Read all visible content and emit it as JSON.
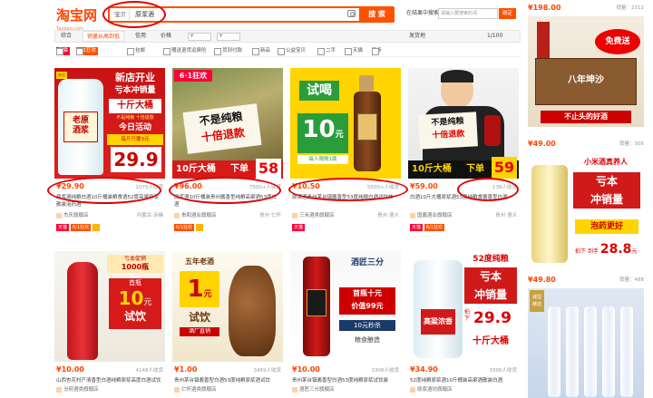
{
  "header": {
    "logo": "淘宝网",
    "logo_sub": "Taobao.com",
    "search_tab": "宝贝",
    "search_value": "原浆酒",
    "search_button": "搜 索",
    "instore_label": "在结果中搜索",
    "instore_placeholder": "请输入要搜索的词",
    "instore_button": "确定"
  },
  "sortbar": {
    "items": [
      "综合",
      "销量从高到低",
      "信用",
      "价格"
    ],
    "price_from": "¥",
    "price_to": "¥",
    "ship": "发货地",
    "page": "1/100"
  },
  "filters": [
    "包邮",
    "赠送退货运费险",
    "货到付款",
    "新品",
    "公益宝贝",
    "二手",
    "天猫",
    "更多"
  ],
  "products": [
    {
      "price": "¥29.90",
      "sold": "1075人收货",
      "title": "原浆酒纯粮白酒10斤桶装粮食酒52度高粱原浆散装泡药酒",
      "shop": "杰庆旗舰店",
      "loc": "内蒙古 赤峰",
      "img_texts": [
        "新店开业",
        "亏本冲销量",
        "老原",
        "酒浆",
        "十斤大桶",
        "不是纯粮 十倍退款",
        "今日活动",
        "29.9",
        "每斤只要3元"
      ]
    },
    {
      "price": "¥96.00",
      "sold": "7500+人收货",
      "title": "原浆酒10斤桶装贵州酱香型纯粮高粱酒53度白酒",
      "shop": "贵和酒业旗舰店",
      "loc": "贵州 仁怀",
      "img_texts": [
        "6·1狂欢",
        "不是纯粮",
        "十倍退款",
        "10斤大桶",
        "下单",
        "58"
      ]
    },
    {
      "price": "¥10.50",
      "sold": "5500+人收货",
      "title": "原浆酒贵州茅台镇酱香型53度纯粮白酒试饮装",
      "shop": "三禾酒类旗舰店",
      "loc": "贵州 遵义",
      "img_texts": [
        "试喝",
        "10",
        "元",
        "每人限购1瓶"
      ]
    },
    {
      "price": "¥59.00",
      "sold": "138人收货",
      "title": "白酒10斤大桶原浆酒53度纯粮食酱香型白酒",
      "shop": "国酱酒业旗舰店",
      "loc": "贵州 遵义",
      "img_texts": [
        "不是纯粮",
        "十倍退款",
        "10斤大桶",
        "下单",
        "59"
      ]
    },
    {
      "price": "¥10.00",
      "sold": "4148人收货",
      "title": "山西杏花村产清香型白酒纯粮原浆高度白酒试饮装",
      "shop": "汾府酒类旗舰店",
      "loc": "山西 吕梁",
      "img_texts": [
        "亏本促销",
        "1000瓶",
        "首瓶",
        "10",
        "元",
        "试饮"
      ]
    },
    {
      "price": "¥1.00",
      "sold": "3459人收货",
      "title": "贵州茅台镇酱香型白酒53度纯粮原浆酒试饮",
      "shop": "仁怀酒类旗舰店",
      "loc": "贵州 遵义",
      "img_texts": [
        "五年老酒",
        "1",
        "元",
        "试饮",
        "酒厂直销"
      ]
    },
    {
      "price": "¥10.00",
      "sold": "3306人收货",
      "title": "贵州茅台镇酱香型白酒53度纯粮原浆试饮装",
      "shop": "酒匠三分旗舰店",
      "loc": "贵州 遵义",
      "img_texts": [
        "酒匠三分",
        "首瓶十元",
        "价值99元",
        "10元秒杀",
        "粮食酿造"
      ]
    },
    {
      "price": "¥34.90",
      "sold": "3300人收货",
      "title": "52度纯粮原浆酒10斤桶装高粱酒散装白酒",
      "shop": "原浆酒坊旗舰店",
      "loc": "山东 菏泽",
      "img_texts": [
        "52度纯粮",
        "亏本",
        "冲销量",
        "拍下",
        "29.9",
        "十斤大桶",
        "高粱浓香"
      ]
    }
  ],
  "side": [
    {
      "price": "¥198.00",
      "count": "销量：2312",
      "img_texts": [
        "免费送",
        "八年坤沙",
        "不止头的好酒"
      ]
    },
    {
      "price": "¥49.00",
      "count": "销量：306",
      "img_texts": [
        "小米酒真养人",
        "亏本",
        "冲销量",
        "泡药更好",
        "拍下",
        "到手",
        "28.8",
        "元"
      ]
    },
    {
      "price": "¥49.80",
      "count": "销量：488",
      "img_texts": [
        "诚恒",
        "精选"
      ]
    }
  ]
}
